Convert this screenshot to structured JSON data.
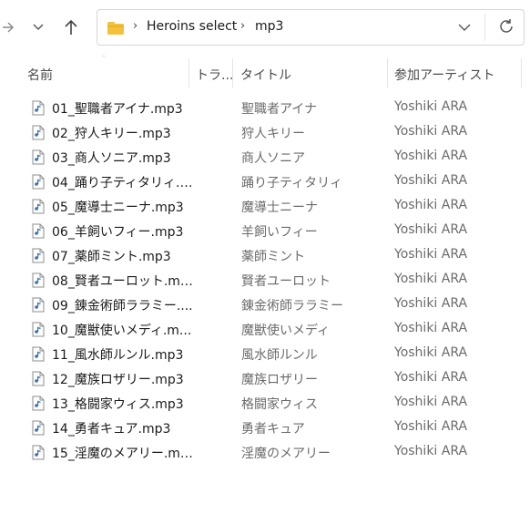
{
  "address_bar": {
    "path": [
      "Heroins select",
      "mp3"
    ]
  },
  "columns": {
    "name": "名前",
    "track": "トラ...",
    "title": "タイトル",
    "artist": "参加アーティスト"
  },
  "files": [
    {
      "name": "01_聖職者アイナ.mp3",
      "title": "聖職者アイナ",
      "artist": "Yoshiki ARA"
    },
    {
      "name": "02_狩人キリー.mp3",
      "title": "狩人キリー",
      "artist": "Yoshiki ARA"
    },
    {
      "name": "03_商人ソニア.mp3",
      "title": "商人ソニア",
      "artist": "Yoshiki ARA"
    },
    {
      "name": "04_踊り子ティタリィ.m...",
      "title": "踊り子ティタリィ",
      "artist": "Yoshiki ARA"
    },
    {
      "name": "05_魔導士ニーナ.mp3",
      "title": "魔導士ニーナ",
      "artist": "Yoshiki ARA"
    },
    {
      "name": "06_羊飼いフィー.mp3",
      "title": "羊飼いフィー",
      "artist": "Yoshiki ARA"
    },
    {
      "name": "07_薬師ミント.mp3",
      "title": "薬師ミント",
      "artist": "Yoshiki ARA"
    },
    {
      "name": "08_賢者ユーロット.mp3",
      "title": "賢者ユーロット",
      "artist": "Yoshiki ARA"
    },
    {
      "name": "09_錬金術師ララミー....",
      "title": "錬金術師ララミー",
      "artist": "Yoshiki ARA"
    },
    {
      "name": "10_魔獣使いメディ.m...",
      "title": "魔獣使いメディ",
      "artist": "Yoshiki ARA"
    },
    {
      "name": "11_風水師ルンル.mp3",
      "title": "風水師ルンル",
      "artist": "Yoshiki ARA"
    },
    {
      "name": "12_魔族ロザリー.mp3",
      "title": "魔族ロザリー",
      "artist": "Yoshiki ARA"
    },
    {
      "name": "13_格闘家ウィス.mp3",
      "title": "格闘家ウィス",
      "artist": "Yoshiki ARA"
    },
    {
      "name": "14_勇者キュア.mp3",
      "title": "勇者キュア",
      "artist": "Yoshiki ARA"
    },
    {
      "name": "15_淫魔のメアリー.mp3",
      "title": "淫魔のメアリー",
      "artist": "Yoshiki ARA"
    }
  ],
  "icons": {
    "back": "arrow-right-icon",
    "recent": "chevron-down-icon",
    "up": "arrow-up-icon",
    "folder": "folder-icon",
    "dropdown": "chevron-down-icon",
    "refresh": "refresh-icon",
    "file": "mp3-file-icon",
    "sort": "sort-ascending-icon"
  },
  "colors": {
    "folder": "#f3c13a",
    "text_primary": "#1a1a1a",
    "text_secondary": "#6b6b6b",
    "border": "#d6d6d6"
  }
}
